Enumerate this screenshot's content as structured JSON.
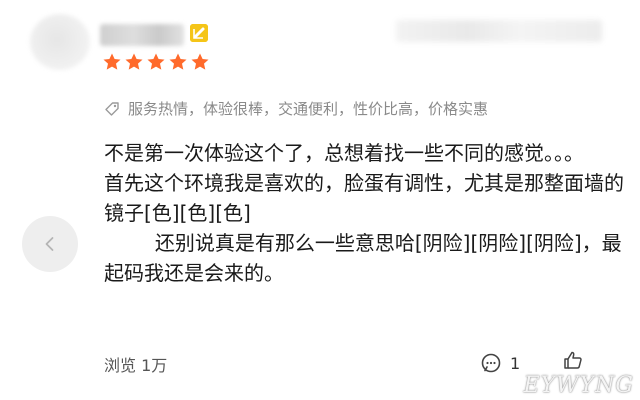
{
  "review": {
    "rating": 5,
    "max_rating": 5,
    "tags": "服务热情，体验很棒，交通便利，性价比高，价格实惠",
    "paragraphs": [
      "不是第一次体验这个了，总想着找一些不同的感觉。。。",
      "首先这个环境我是喜欢的，脸蛋有调性，尤其是那整面墙的镜子[色][色][色]",
      "        还别说真是有那么一些意思哈[阴险][阴险][阴险]，最起码我还是会来的。"
    ]
  },
  "footer": {
    "views": "浏览 1万",
    "comment_count": "1"
  },
  "colors": {
    "star": "#ff6a2b",
    "badge": "#f5c518",
    "tag_text": "#8a8a8a"
  },
  "icons": {
    "tag": "tag-icon",
    "comment": "comment-icon",
    "like": "thumbs-up-icon",
    "prev": "chevron-left-icon",
    "badge": "vip-badge-icon"
  }
}
